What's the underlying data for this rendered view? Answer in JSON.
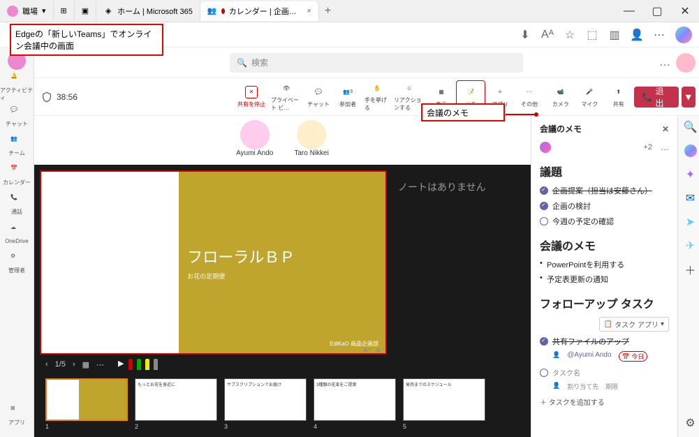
{
  "titlebar": {
    "profile_label": "職場",
    "tab1": "ホーム | Microsoft 365",
    "tab2": "カレンダー | 企画会議 | Micros…",
    "close_x": "×",
    "plus": "+"
  },
  "window_controls": {
    "min": "—",
    "max": "▢",
    "close": "✕"
  },
  "annotation_main": "Edgeの「新しいTeams」でオンライン会議中の画面",
  "annotation_notes": "会議のメモ",
  "rail": {
    "activity": "アクティビティ",
    "chat": "チャット",
    "teams": "チーム",
    "calendar": "カレンダー",
    "calls": "通話",
    "onedrive": "OneDrive",
    "admin": "管理者",
    "apps": "アプリ"
  },
  "search": {
    "placeholder": "検索"
  },
  "topbar": {
    "more": "…"
  },
  "meeting": {
    "timer": "38:56",
    "stop_share": "共有を停止",
    "private_view": "プライベート ビ…",
    "chat": "チャット",
    "people": "参加者",
    "people_count": "3",
    "raise_hand": "手を挙げる",
    "react": "リアクションする",
    "view": "表示",
    "notes": "メモ",
    "apps": "アプリ",
    "more": "その他",
    "camera": "カメラ",
    "mic": "マイク",
    "share": "共有",
    "leave": "退出"
  },
  "participants": {
    "p1": "Ayumi Ando",
    "p2": "Taro Nikkei"
  },
  "slide": {
    "title": "フローラルＢＰ",
    "subtitle": "お花の定期便",
    "footer": "EdiKaO 商品企画部",
    "notes_empty": "ノートはありません",
    "page": "1/5",
    "font_big": "A⁺",
    "font_small": "A⁻"
  },
  "thumbs": [
    "1",
    "2",
    "3",
    "4",
    "5"
  ],
  "thumb_titles": {
    "t2": "もっとお花を身近に",
    "t3": "サブスクリプションでお届け",
    "t4": "3種類の花束をご提案",
    "t5": "発売までのスケジュール"
  },
  "notes_panel": {
    "title": "会議のメモ",
    "plus2": "+2",
    "more": "…",
    "agenda_title": "議題",
    "agenda1": "企画提案（担当は安藤さん）",
    "agenda2": "企画の検討",
    "agenda3": "今週の予定の確認",
    "notes_title": "会議のメモ",
    "note1": "PowerPointを利用する",
    "note2": "予定表更新の通知",
    "followup_title": "フォローアップ タスク",
    "task_app": "タスク アプリ",
    "task1": "共有ファイルのアップ",
    "task1_mention": "@Ayumi Ando",
    "task1_date": "今日",
    "task_name_ph": "タスク名",
    "assign_ph": "割り当て先",
    "due_ph": "期限",
    "add_task": "タスクを追加する"
  },
  "icons": {
    "search": "⌕",
    "calendar_date": "📅",
    "person": "👤"
  }
}
